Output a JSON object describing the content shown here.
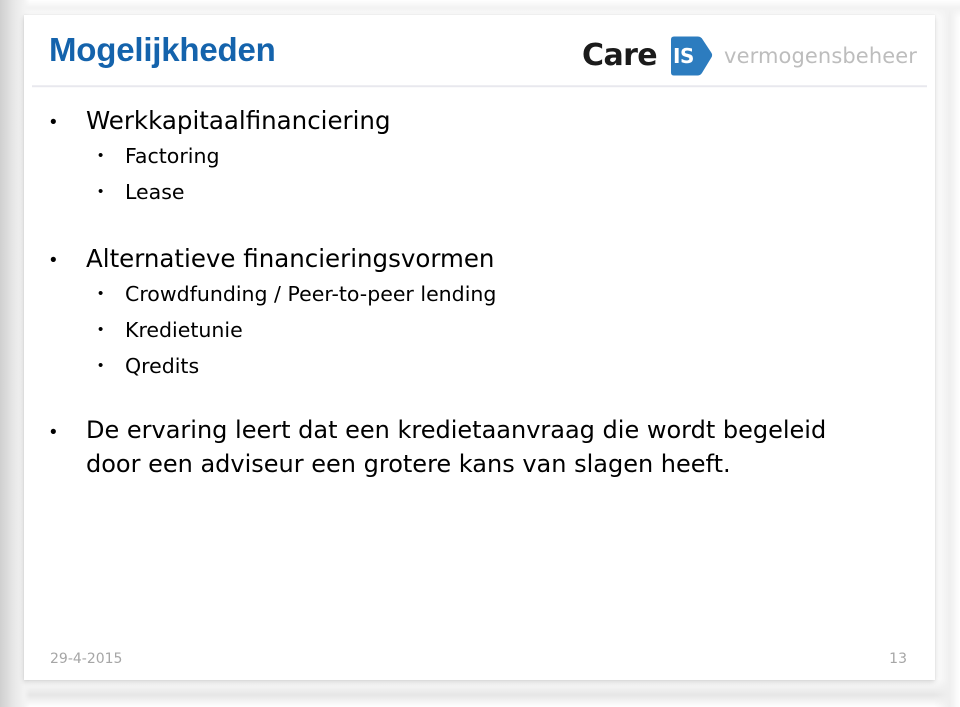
{
  "slide": {
    "title": "Mogelijkheden",
    "title_color": "#1463AC",
    "background_color": "#FFFFFF"
  },
  "logo": {
    "wordmark": "Care",
    "badge_text": "IS",
    "badge_color": "#2C7CBF",
    "tagline": "vermogensbeheer",
    "tagline_color": "#BDBDBD",
    "wordmark_color": "#1B1B1B"
  },
  "content": {
    "bullet_glyph_level1": "•",
    "bullet_glyph_level2": "•",
    "groups": [
      {
        "heading": "Werkkapitaalfinanciering",
        "items": [
          "Factoring",
          "Lease"
        ]
      },
      {
        "heading": "Alternatieve financieringsvormen",
        "items": [
          "Crowdfunding / Peer-to-peer lending",
          "Kredietunie",
          "Qredits"
        ]
      }
    ],
    "closing_note": "De ervaring leert dat een kredietaanvraag die wordt begeleid door een adviseur een grotere kans van slagen heeft."
  },
  "footer": {
    "date": "29-4-2015",
    "page_number": "13",
    "text_color": "#A6A6A6"
  }
}
